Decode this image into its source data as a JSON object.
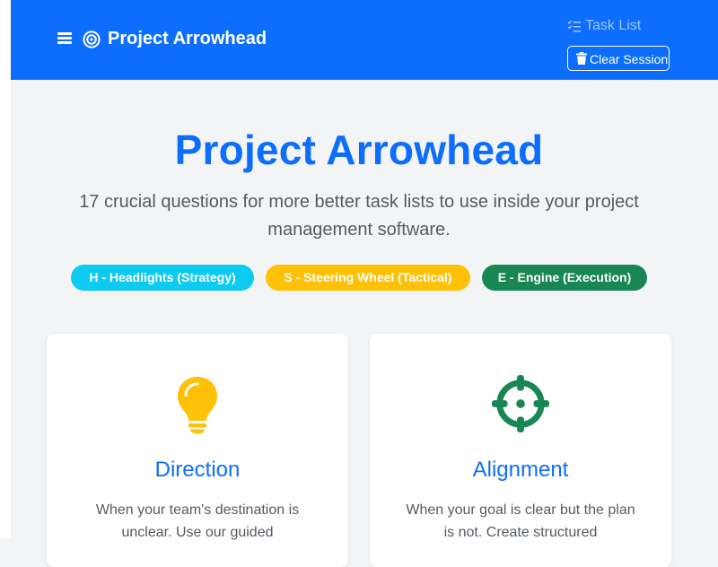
{
  "navbar": {
    "menu_icon": "hamburger-icon",
    "brand_icon": "bullseye-icon",
    "brand": "Project Arrowhead",
    "task_list": {
      "label": "Task List",
      "icon": "checklist-icon"
    },
    "clear_session": {
      "label": "Clear Session",
      "icon": "trash-icon"
    },
    "color": "#0d6efd"
  },
  "hero": {
    "title": "Project Arrowhead",
    "subtitle": "17 crucial questions for more better task lists to use inside your project management software."
  },
  "pills": [
    {
      "label": "H - Headlights (Strategy)",
      "color": "#0dcaf0"
    },
    {
      "label": "S - Steering Wheel (Tactical)",
      "color": "#ffc107"
    },
    {
      "label": "E - Engine (Execution)",
      "color": "#198754"
    }
  ],
  "cards": [
    {
      "icon": "lightbulb-icon",
      "icon_color": "#ffc107",
      "title": "Direction",
      "text": "When your team's destination is unclear. Use our guided"
    },
    {
      "icon": "crosshair-icon",
      "icon_color": "#198754",
      "title": "Alignment",
      "text": "When your goal is clear but the plan is not. Create structured"
    }
  ]
}
